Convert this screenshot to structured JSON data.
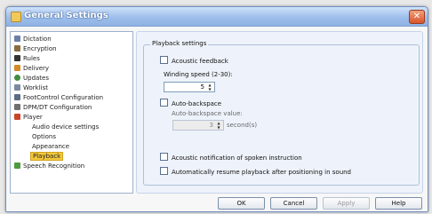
{
  "window": {
    "title": "General Settings"
  },
  "tree": {
    "items": [
      {
        "label": "Dictation",
        "icon": "dictation-icon",
        "color": "#6a7fa8"
      },
      {
        "label": "Encryption",
        "icon": "encryption-icon",
        "color": "#8a6b3e"
      },
      {
        "label": "Rules",
        "icon": "rules-icon",
        "color": "#333333"
      },
      {
        "label": "Delivery",
        "icon": "delivery-icon",
        "color": "#d48a2a"
      },
      {
        "label": "Updates",
        "icon": "updates-icon",
        "color": "#3f8f3f"
      },
      {
        "label": "Worklist",
        "icon": "worklist-icon",
        "color": "#7a8aa0"
      },
      {
        "label": "FootControl Configuration",
        "icon": "footcontrol-icon",
        "color": "#5b6d85"
      },
      {
        "label": "DPM/DT Configuration",
        "icon": "device-icon",
        "color": "#707070"
      },
      {
        "label": "Player",
        "icon": "player-icon",
        "color": "#c9452a"
      },
      {
        "label": "Audio device settings",
        "icon": "",
        "color": ""
      },
      {
        "label": "Options",
        "icon": "",
        "color": ""
      },
      {
        "label": "Appearance",
        "icon": "",
        "color": ""
      },
      {
        "label": "Playback",
        "icon": "",
        "color": ""
      },
      {
        "label": "Speech Recognition",
        "icon": "speech-recognition-icon",
        "color": "#4e9a3e"
      }
    ]
  },
  "playback": {
    "group_title": "Playback settings",
    "acoustic_feedback": "Acoustic feedback",
    "winding_speed_label": "Winding speed (2-30):",
    "winding_speed_value": "5",
    "auto_backspace": "Auto-backspace",
    "auto_backspace_value_label": "Auto-backspace value:",
    "auto_backspace_value": "3",
    "seconds_label": "second(s)",
    "acoustic_notification": "Acoustic notification of spoken instruction",
    "auto_resume": "Automatically resume playback after positioning in sound"
  },
  "buttons": {
    "ok": "OK",
    "cancel": "Cancel",
    "apply": "Apply",
    "help": "Help"
  }
}
